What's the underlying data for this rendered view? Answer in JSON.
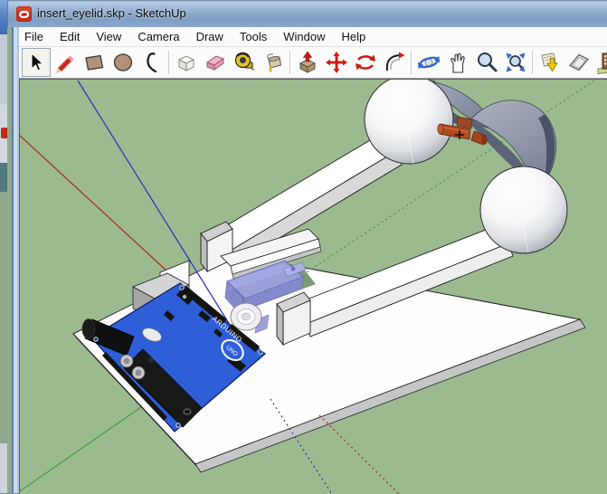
{
  "window": {
    "title": "insert_eyelid.skp - SketchUp",
    "app_icon": "sketchup-logo"
  },
  "menu_bar": {
    "items": [
      "File",
      "Edit",
      "View",
      "Camera",
      "Draw",
      "Tools",
      "Window",
      "Help"
    ]
  },
  "toolbar": {
    "active_tool": "Select",
    "tools": [
      {
        "id": "select",
        "name": "Select"
      },
      {
        "id": "line",
        "name": "Line"
      },
      {
        "id": "rectangle",
        "name": "Rectangle"
      },
      {
        "id": "circle",
        "name": "Circle"
      },
      {
        "id": "arc",
        "name": "Arc"
      },
      {
        "id": "make-component",
        "name": "Make Component"
      },
      {
        "id": "eraser",
        "name": "Eraser"
      },
      {
        "id": "tape-measure",
        "name": "Tape Measure"
      },
      {
        "id": "paint-bucket",
        "name": "Paint Bucket"
      },
      {
        "id": "push-pull",
        "name": "Push/Pull"
      },
      {
        "id": "move",
        "name": "Move"
      },
      {
        "id": "rotate",
        "name": "Rotate"
      },
      {
        "id": "offset",
        "name": "Offset"
      },
      {
        "id": "orbit",
        "name": "Orbit"
      },
      {
        "id": "pan",
        "name": "Pan"
      },
      {
        "id": "zoom",
        "name": "Zoom"
      },
      {
        "id": "zoom-extents",
        "name": "Zoom Extents"
      },
      {
        "id": "get-models",
        "name": "Get Models"
      },
      {
        "id": "section-plane",
        "name": "Section Plane"
      },
      {
        "id": "3d-warehouse",
        "name": "3D Warehouse"
      }
    ]
  },
  "viewport": {
    "background_color": "#9CBA8F",
    "axis_colors": {
      "red": "#A8261C",
      "green": "#3E9C40",
      "blue": "#2330BE"
    },
    "model": {
      "arduino_label": "ARDUINO",
      "arduino_logo": "UNO"
    }
  }
}
